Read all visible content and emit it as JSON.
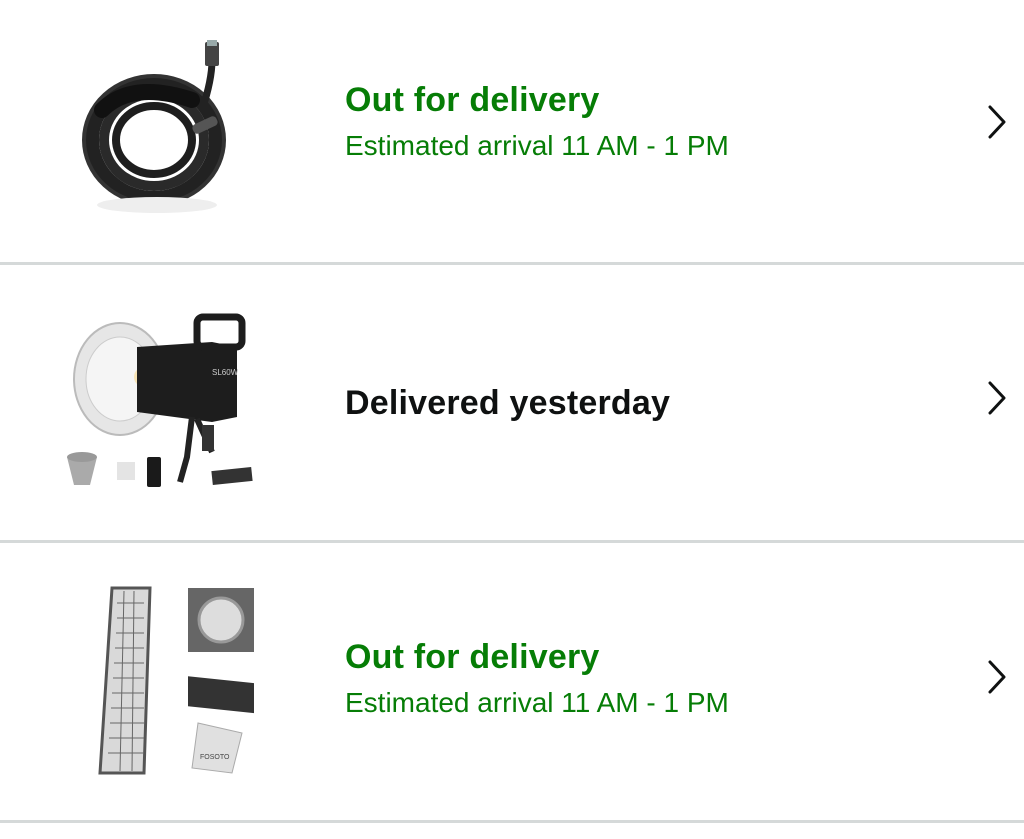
{
  "orders": [
    {
      "status": "Out for delivery",
      "eta": "Estimated arrival 11 AM - 1 PM",
      "status_color": "#067d06",
      "image_icon": "usb-cable-product-image",
      "chevron_icon": "chevron-right-icon"
    },
    {
      "status": "Delivered yesterday",
      "eta": "",
      "status_color": "#0f1111",
      "image_icon": "studio-light-product-image",
      "chevron_icon": "chevron-right-icon"
    },
    {
      "status": "Out for delivery",
      "eta": "Estimated arrival 11 AM - 1 PM",
      "status_color": "#067d06",
      "image_icon": "softbox-product-image",
      "chevron_icon": "chevron-right-icon"
    }
  ]
}
